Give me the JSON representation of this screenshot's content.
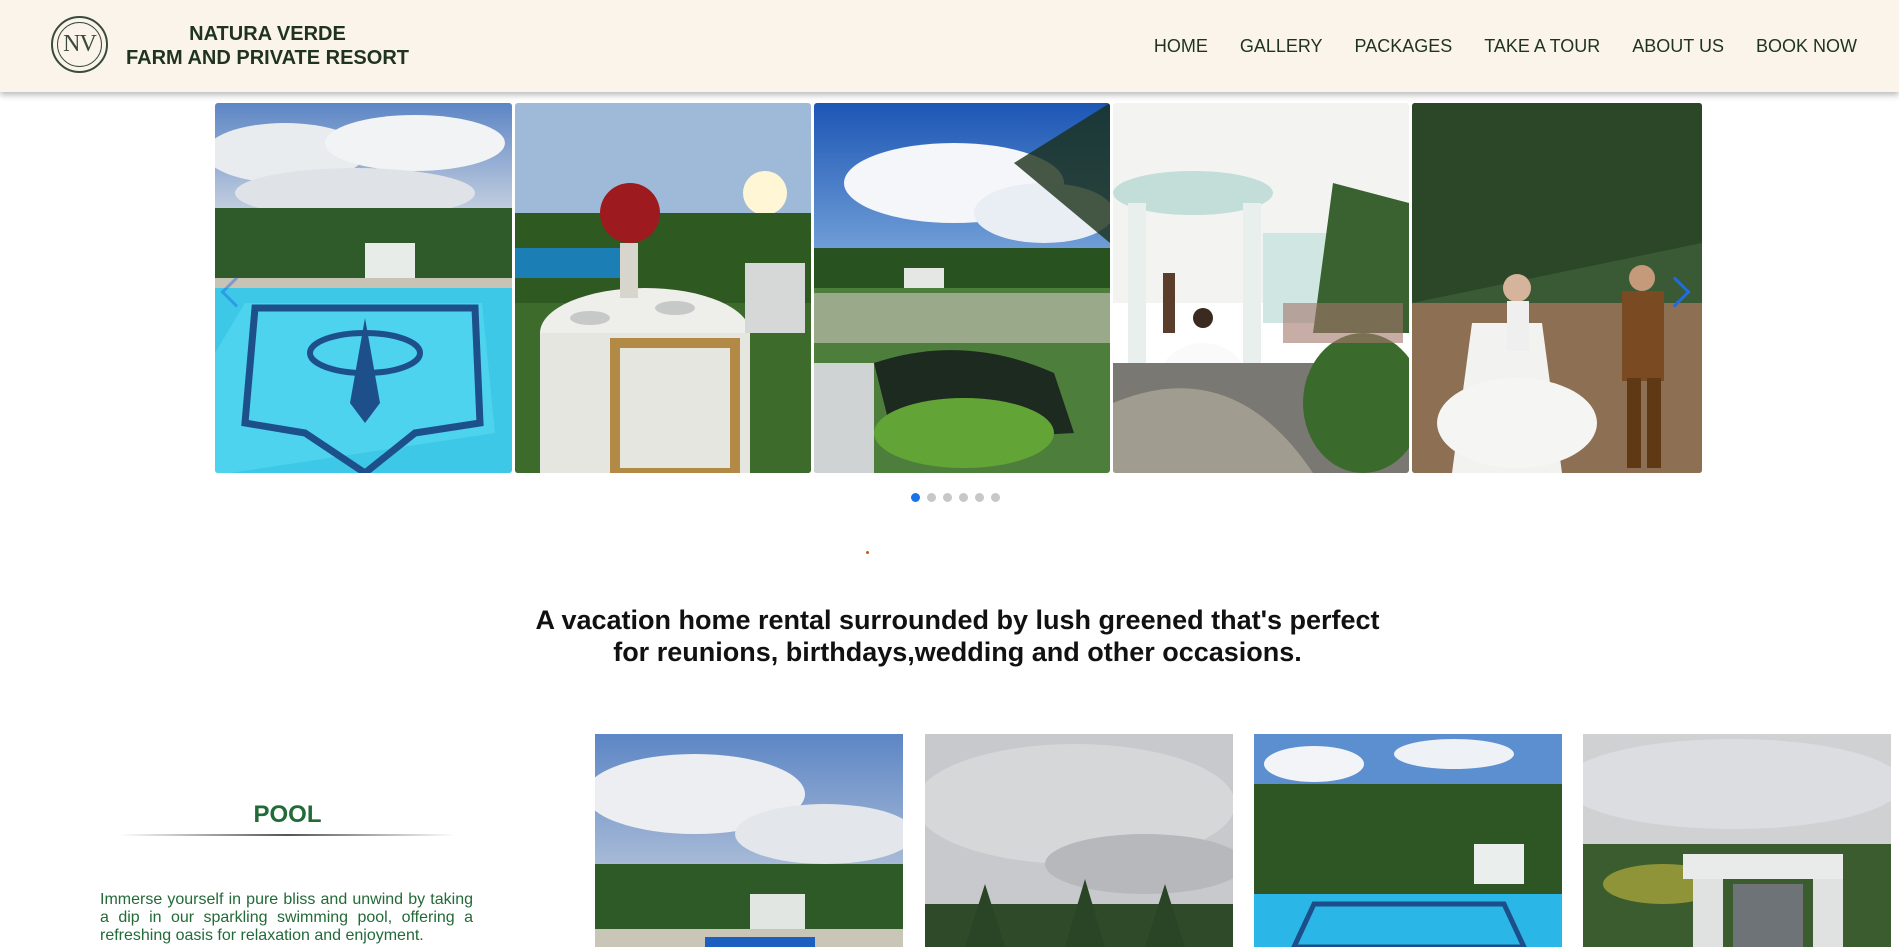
{
  "brand": {
    "line1": "NATURA VERDE",
    "line2": "FARM AND PRIVATE RESORT",
    "logo_text": "NV"
  },
  "nav": {
    "home": "HOME",
    "gallery": "GALLERY",
    "packages": "PACKAGES",
    "tour": "TAKE A TOUR",
    "about": "ABOUT US",
    "book": "BOOK NOW"
  },
  "carousel": {
    "slides": [
      "pool-photo",
      "dining-table-photo",
      "garden-pond-photo",
      "gazebo-wedding-photo",
      "bride-groom-photo"
    ],
    "dot_count": 6,
    "active_dot": 1
  },
  "tagline": {
    "line1": "A vacation home rental surrounded by lush greened that's perfect",
    "line2": "for reunions, birthdays,wedding and other occasions."
  },
  "pool": {
    "title": "POOL",
    "description": "Immerse yourself in pure bliss and unwind by taking a dip in our sparkling swimming pool, offering a refreshing oasis for relaxation and enjoyment."
  },
  "colors": {
    "header_bg": "#faf4ea",
    "heading_green": "#226a37",
    "accent_blue": "#1a73e8"
  }
}
